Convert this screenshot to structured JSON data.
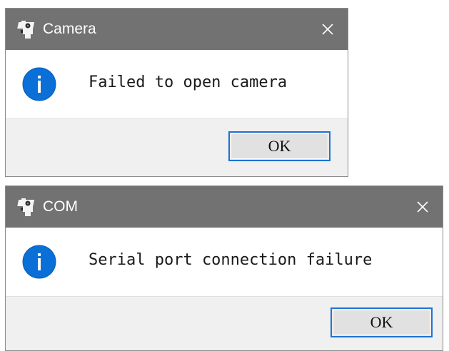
{
  "dialogs": [
    {
      "title": "Camera",
      "message": "Failed to open camera",
      "ok_label": "OK",
      "icons": {
        "app": "camera-app-icon",
        "status": "info-icon",
        "close": "close-icon"
      }
    },
    {
      "title": "COM",
      "message": "Serial port connection failure",
      "ok_label": "OK",
      "icons": {
        "app": "camera-app-icon",
        "status": "info-icon",
        "close": "close-icon"
      }
    }
  ],
  "colors": {
    "titlebar": "#727272",
    "info_icon": "#0a6fd6",
    "button_border": "#1e73d2",
    "footer": "#f0f0f0"
  }
}
